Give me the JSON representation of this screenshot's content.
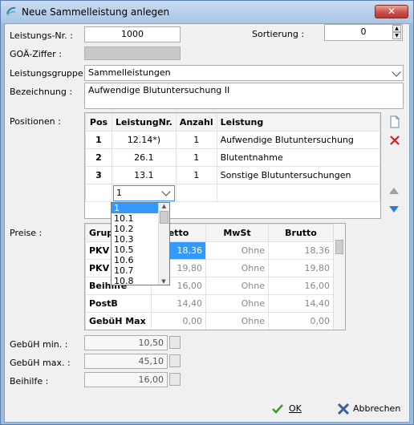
{
  "window": {
    "title": "Neue Sammelleistung anlegen",
    "close": "✕"
  },
  "form": {
    "leistungsnr_label": "Leistungs-Nr. :",
    "leistungsnr_value": "1000",
    "sortierung_label": "Sortierung :",
    "sortierung_value": "0",
    "goae_label": "GOÄ-Ziffer :",
    "gruppe_label": "Leistungsgruppe :",
    "gruppe_value": "Sammelleistungen",
    "bezeichnung_label": "Bezeichnung :",
    "bezeichnung_value": "Aufwendige Blutuntersuchung II",
    "positionen_label": "Positionen :",
    "preise_label": "Preise :"
  },
  "positionen": {
    "headers": [
      "Pos",
      "LeistungNr.",
      "Anzahl",
      "Leistung"
    ],
    "rows": [
      {
        "pos": "1",
        "nr": "12.14*)",
        "anzahl": "1",
        "leistung": "Aufwendige Blutuntersuchung"
      },
      {
        "pos": "2",
        "nr": "26.1",
        "anzahl": "1",
        "leistung": "Blutentnahme"
      },
      {
        "pos": "3",
        "nr": "13.1",
        "anzahl": "1",
        "leistung": "Sonstige Blutuntersuchungen"
      }
    ],
    "edit_value": "1"
  },
  "dropdown": {
    "items": [
      "1",
      "10.1",
      "10.2",
      "10.3",
      "10.5",
      "10.6",
      "10.7",
      "10.8"
    ]
  },
  "preise": {
    "headers": [
      "Grupp",
      "etto",
      "MwSt",
      "Brutto"
    ],
    "rows": [
      {
        "gruppe": "PKV 1",
        "netto": "18,36",
        "mwst": "Ohne",
        "brutto": "18,36"
      },
      {
        "gruppe": "PKV 2",
        "netto": "19,80",
        "mwst": "Ohne",
        "brutto": "19,80"
      },
      {
        "gruppe": "Beihilfe",
        "netto": "16,00",
        "mwst": "Ohne",
        "brutto": "16,00"
      },
      {
        "gruppe": "PostB",
        "netto": "14,40",
        "mwst": "Ohne",
        "brutto": "14,40"
      },
      {
        "gruppe": "GebüH Max",
        "netto": "0,00",
        "mwst": "Ohne",
        "brutto": "0,00"
      }
    ]
  },
  "summary": {
    "min_label": "GebüH min. :",
    "min_value": "10,50",
    "max_label": "GebüH max. :",
    "max_value": "45,10",
    "beihilfe_label": "Beihilfe :",
    "beihilfe_value": "16,00"
  },
  "buttons": {
    "ok": "OK",
    "cancel": "Abbrechen"
  },
  "colors": {
    "selection": "#3399ff",
    "ok_icon": "#3a9a2a",
    "cancel_icon": "#3a5f9a",
    "delete_icon": "#d02020",
    "arrow_down": "#2a7fd0"
  }
}
